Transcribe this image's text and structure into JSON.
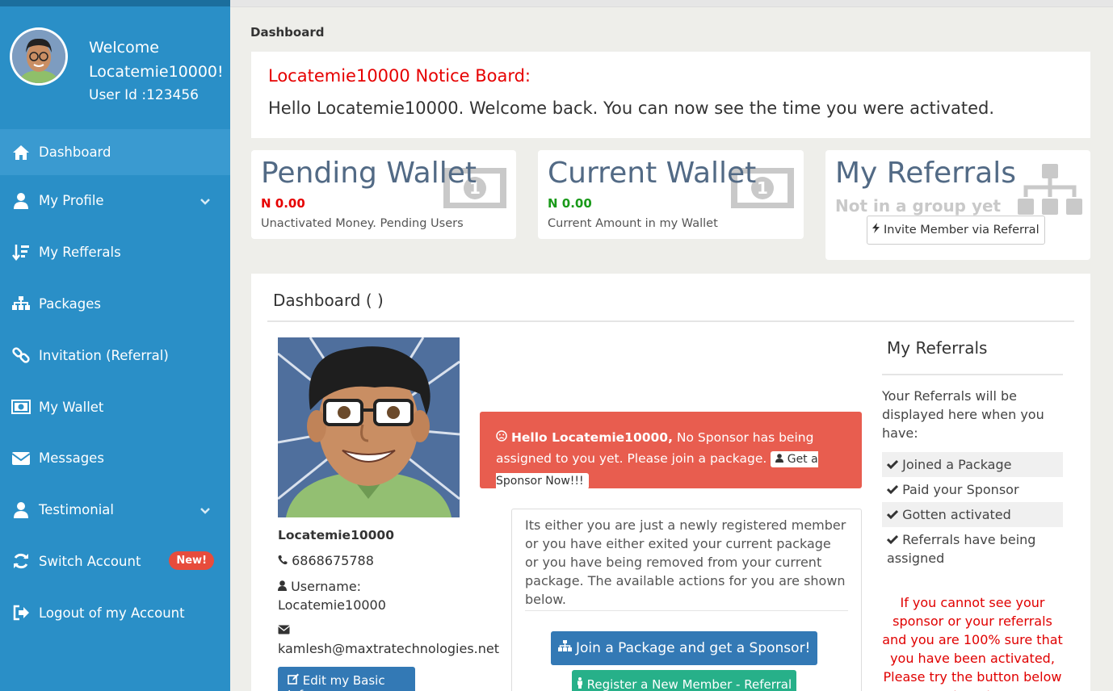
{
  "sidebar": {
    "welcome": "Welcome",
    "username": "Locatemie10000!",
    "user_id": "User Id :123456",
    "items": [
      {
        "label": "Dashboard",
        "icon": "home-icon"
      },
      {
        "label": "My Profile",
        "icon": "user-icon"
      },
      {
        "label": "My Refferals",
        "icon": "sort-amount-icon"
      },
      {
        "label": "Packages",
        "icon": "sitemap-icon"
      },
      {
        "label": "Invitation (Referral)",
        "icon": "link-icon"
      },
      {
        "label": "My Wallet",
        "icon": "money-icon"
      },
      {
        "label": "Messages",
        "icon": "envelope-icon"
      },
      {
        "label": "Testimonial",
        "icon": "user-icon"
      },
      {
        "label": "Switch Account",
        "icon": "refresh-icon",
        "badge": "New!"
      },
      {
        "label": "Logout of my Account",
        "icon": "sign-out-icon"
      }
    ]
  },
  "page": {
    "title": "Dashboard"
  },
  "notice": {
    "title": "Locatemie10000 Notice Board:",
    "body": "Hello Locatemie10000. Welcome back. You can now see the time you were activated."
  },
  "cards": {
    "pending": {
      "title": "Pending Wallet",
      "amount": "N 0.00",
      "desc": "Unactivated Money. Pending Users"
    },
    "current": {
      "title": "Current Wallet",
      "amount": "N 0.00",
      "desc": "Current Amount in my Wallet"
    },
    "referrals": {
      "title": "My Referrals",
      "status": "Not in a group yet",
      "button": "Invite Member via Referral"
    }
  },
  "dashboard": {
    "title": "Dashboard ( )",
    "profile": {
      "name": "Locatemie10000",
      "phone": "6868675788",
      "username_label": "Username:",
      "username": "Locatemie10000",
      "email": "kamlesh@maxtratechnologies.net",
      "edit_button": "Edit my Basic Info"
    },
    "alert": {
      "strong": "Hello Locatemie10000,",
      "text": "No Sponsor has being assigned to you yet. Please join a package.",
      "button": "Get a Sponsor Now!!!"
    },
    "info": {
      "text": "Its either you are just a newly registered member or you have either exited your current package or you have being removed from your current package. The available actions for you are shown below.",
      "join_button": "Join a Package and get a Sponsor!",
      "register_button": "Register a New Member - Referral"
    },
    "referrals_panel": {
      "title": "My Referrals",
      "desc": "Your Referrals will be displayed here when you have:",
      "checks": [
        "Joined a Package",
        "Paid your Sponsor",
        "Gotten activated",
        "Referrals have being assigned"
      ],
      "warning": "If you cannot see your sponsor or your referrals and you are 100% sure that you have been activated, Please try the button below to get"
    }
  },
  "colors": {
    "sidebar": "#2a8fc7",
    "danger": "#e60000",
    "success": "#1a9a1a",
    "alert": "#e85d4f",
    "primary": "#3379b5",
    "teal": "#27b089"
  }
}
